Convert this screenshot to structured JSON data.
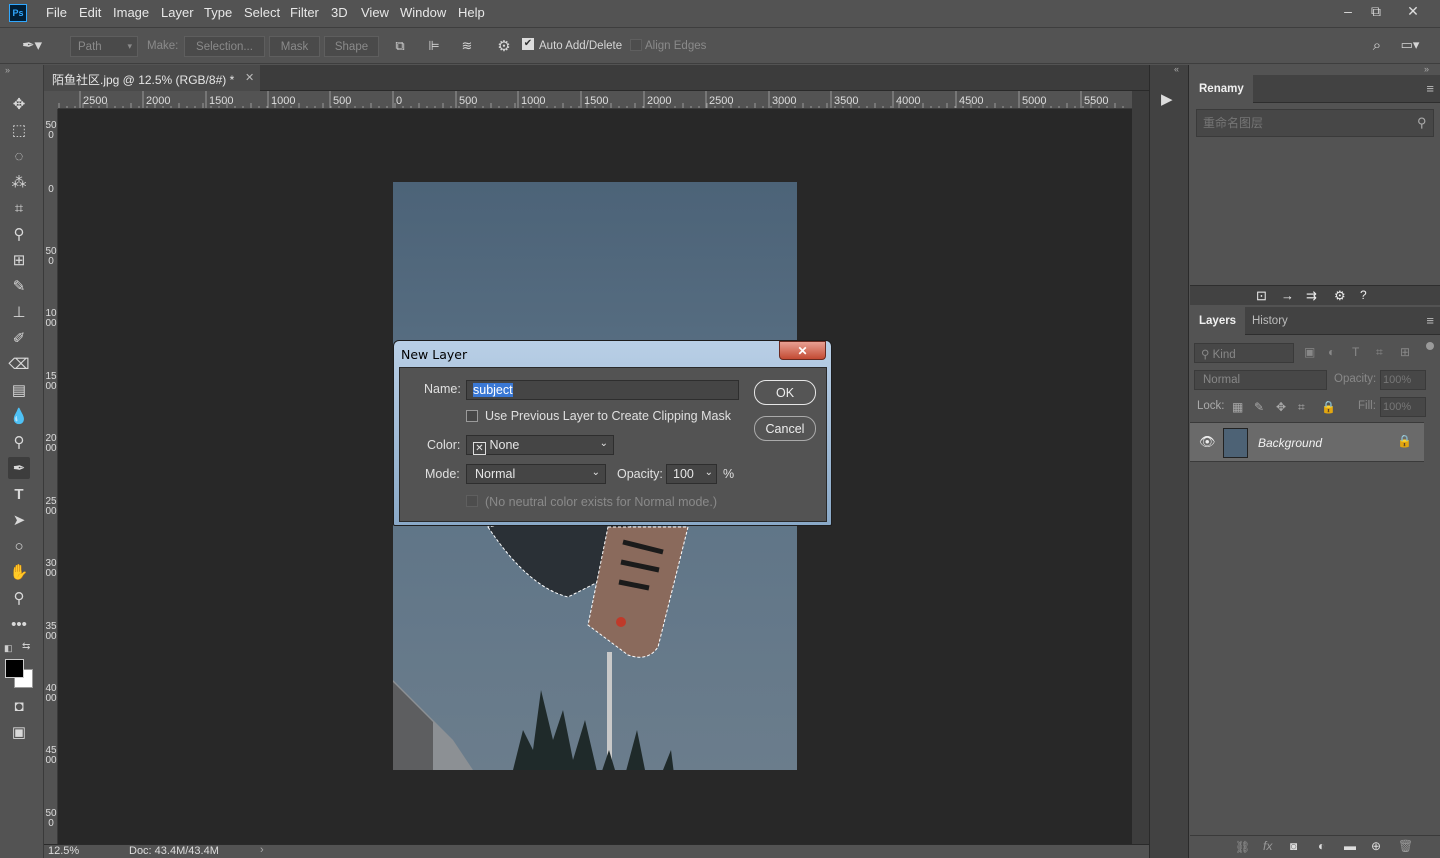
{
  "app": {
    "logo": "Ps"
  },
  "menubar": {
    "items": [
      "File",
      "Edit",
      "Image",
      "Layer",
      "Type",
      "Select",
      "Filter",
      "3D",
      "View",
      "Window",
      "Help"
    ]
  },
  "window_controls": {
    "minimize": "–",
    "restore": "⧉",
    "close": "✕"
  },
  "options_bar": {
    "tool_icon": "pen-icon",
    "mode_value": "Path",
    "make_label": "Make:",
    "selection_button": "Selection...",
    "mask_button": "Mask",
    "shape_button": "Shape",
    "auto_add_delete_label": "Auto Add/Delete",
    "auto_add_delete_checked": true,
    "align_edges_label": "Align Edges",
    "align_edges_checked": false
  },
  "document": {
    "tab_title": "陌鱼社区.jpg @ 12.5% (RGB/8#) *",
    "zoom": "12.5%",
    "doc_size": "Doc: 43.4M/43.4M"
  },
  "rulers": {
    "top_ticks": [
      "2500",
      "2000",
      "1500",
      "1000",
      "500",
      "0",
      "500",
      "1000",
      "1500",
      "2000",
      "2500",
      "3000",
      "3500",
      "4000",
      "4500",
      "5000",
      "5500"
    ],
    "left_ticks": [
      "500",
      "0",
      "500",
      "1000",
      "1500",
      "2000",
      "2500",
      "3000",
      "3500",
      "4000",
      "4500",
      "500"
    ]
  },
  "renamy_panel": {
    "tab": "Renamy",
    "search_placeholder": "重命名图层"
  },
  "layers_panel": {
    "tabs": [
      "Layers",
      "History"
    ],
    "filter_kind": "Kind",
    "blend_mode": "Normal",
    "opacity_label": "Opacity:",
    "opacity_value": "100%",
    "lock_label": "Lock:",
    "fill_label": "Fill:",
    "fill_value": "100%",
    "layers": [
      {
        "name": "Background",
        "visible": true,
        "locked": true
      }
    ]
  },
  "dialog": {
    "title": "New Layer",
    "close": "✕",
    "name_label": "Name:",
    "name_value": "subject",
    "clipping_mask_label": "Use Previous Layer to Create Clipping Mask",
    "clipping_mask_checked": false,
    "color_label": "Color:",
    "color_value": "None",
    "mode_label": "Mode:",
    "mode_value": "Normal",
    "opacity_label": "Opacity:",
    "opacity_value": "100",
    "opacity_unit": "%",
    "neutral_label": "(No neutral color exists for Normal mode.)",
    "ok_button": "OK",
    "cancel_button": "Cancel"
  }
}
